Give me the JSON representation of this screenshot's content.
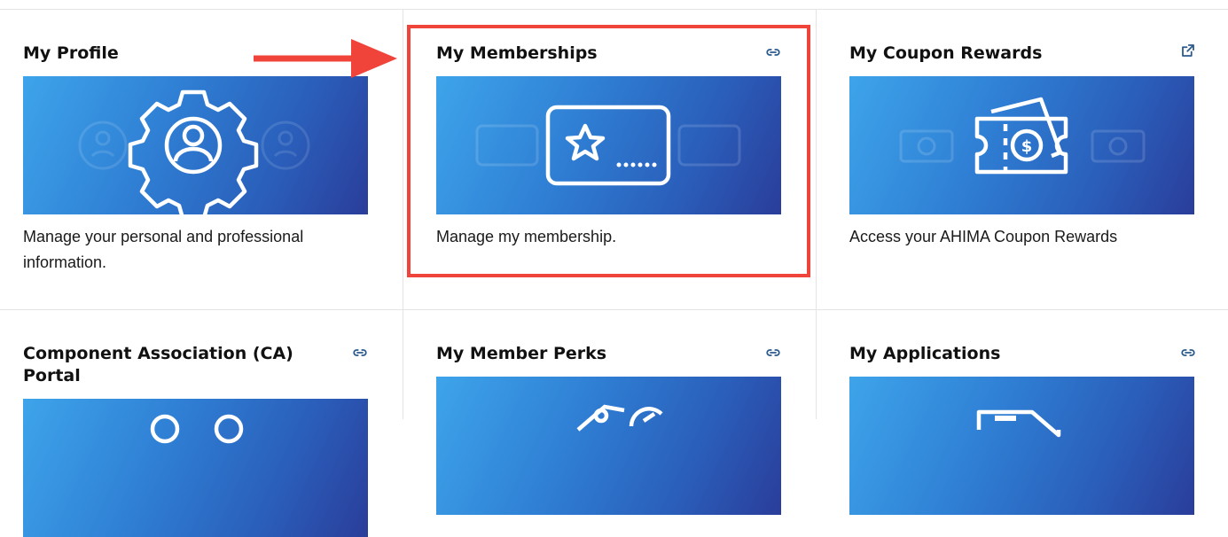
{
  "cards": [
    {
      "title": "My Profile",
      "description": "Manage your personal and professional information.",
      "link_icon": "link-icon"
    },
    {
      "title": "My Memberships",
      "description": "Manage my membership.",
      "link_icon": "link-icon"
    },
    {
      "title": "My Coupon Rewards",
      "description": "Access your AHIMA Coupon Rewards",
      "link_icon": "external-link-icon"
    },
    {
      "title": "Component Association (CA) Portal",
      "link_icon": "link-icon"
    },
    {
      "title": "My Member Perks",
      "link_icon": "link-icon"
    },
    {
      "title": "My Applications",
      "link_icon": "link-icon"
    }
  ],
  "colors": {
    "highlight": "#f0443a",
    "banner_start": "#3ea4ea",
    "banner_end": "#2a3d9a"
  }
}
